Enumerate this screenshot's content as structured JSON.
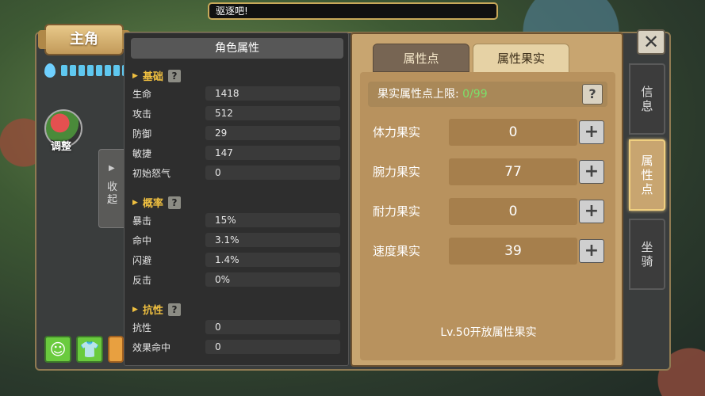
{
  "notice": "驱逐吧!",
  "title": "主角",
  "energy_pips": 8,
  "adjust_label": "调整",
  "collapse": {
    "arrow": "▶",
    "label": "收起"
  },
  "attr_header": "角色属性",
  "sections": {
    "basic": "基础",
    "rate": "概率",
    "resist": "抗性",
    "qmark": "?"
  },
  "basic_rows": [
    {
      "label": "生命",
      "value": "1418"
    },
    {
      "label": "攻击",
      "value": "512"
    },
    {
      "label": "防御",
      "value": "29"
    },
    {
      "label": "敏捷",
      "value": "147"
    },
    {
      "label": "初始怒气",
      "value": "0"
    }
  ],
  "rate_rows": [
    {
      "label": "暴击",
      "value": "15%"
    },
    {
      "label": "命中",
      "value": "3.1%"
    },
    {
      "label": "闪避",
      "value": "1.4%"
    },
    {
      "label": "反击",
      "value": "0%"
    }
  ],
  "resist_rows": [
    {
      "label": "抗性",
      "value": "0"
    },
    {
      "label": "效果命中",
      "value": "0"
    }
  ],
  "tabs": {
    "attr_points": "属性点",
    "attr_fruit": "属性果实"
  },
  "limit": {
    "label": "果实属性点上限:",
    "value": "0/99"
  },
  "fruits": [
    {
      "name": "体力果实",
      "value": "0"
    },
    {
      "name": "腕力果实",
      "value": "77"
    },
    {
      "name": "耐力果实",
      "value": "0"
    },
    {
      "name": "速度果实",
      "value": "39"
    }
  ],
  "plus": "+",
  "unlock_text": "Lv.50开放属性果实",
  "side_tabs": {
    "info": "信息",
    "attr": "属性点",
    "mount": "坐骑"
  },
  "close": "✕",
  "colors": {
    "accent_gold": "#f0c040",
    "limit_green": "#7be06a",
    "panel_tan": "#c8a570"
  }
}
